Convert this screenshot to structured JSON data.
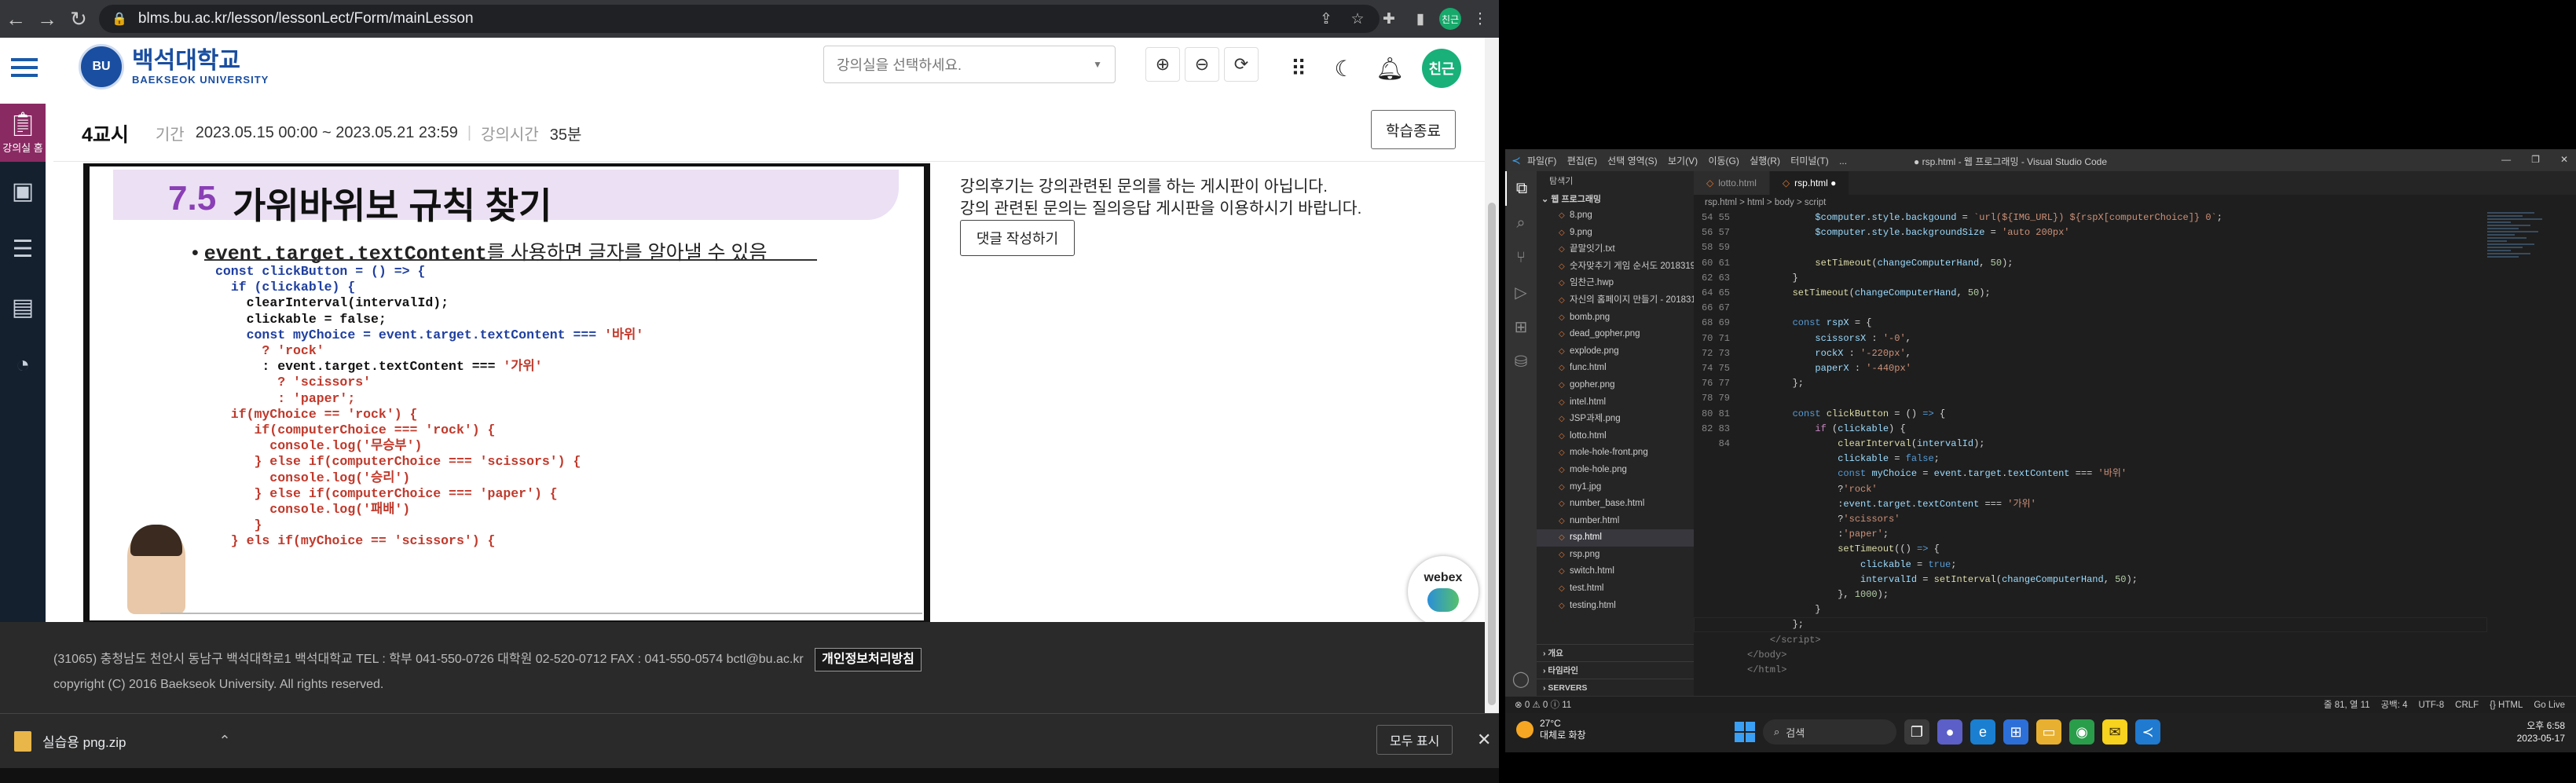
{
  "browser": {
    "url": "blms.bu.ac.kr/lesson/lessonLect/Form/mainLesson",
    "profile": "친근"
  },
  "site": {
    "logo_badge": "BU",
    "name_ko": "백석대학교",
    "name_en": "BAEKSEOK UNIVERSITY",
    "room_placeholder": "강의실을 선택하세요.",
    "user_avatar": "친근",
    "side_label": "강의실 홈"
  },
  "lesson": {
    "name": "4교시",
    "period_label": "기간",
    "period": "2023.05.15 00:00 ~ 2023.05.21 23:59",
    "separator": "|",
    "time_label": "강의시간",
    "time": "35분",
    "end_button": "학습종료"
  },
  "slide": {
    "number": "7.5",
    "title": "가위바위보 규칙 찾기",
    "bullet_code": "event.target.textContent",
    "bullet_rest": "를 사용하면 글자를 알아낼 수 있음"
  },
  "review": {
    "line1": "강의후기는 강의관련된 문의를 하는 게시판이 아닙니다.",
    "line2": "강의 관련된 문의는 질의응답 게시판을 이용하시기 바랍니다.",
    "write_button": "댓글 작성하기"
  },
  "webex": "webex",
  "footer": {
    "address": "(31065) 충청남도 천안시 동남구 백석대학로1 백석대학교 TEL : 학부 041-550-0726 대학원 02-520-0712 FAX : 041-550-0574 bctl@bu.ac.kr",
    "privacy_button": "개인정보처리방침",
    "copyright": "copyright (C) 2016 Baekseok University. All rights reserved."
  },
  "download": {
    "file": "실습용 png.zip",
    "show_all": "모두 표시"
  },
  "vscode": {
    "menus": [
      "파일(F)",
      "편집(E)",
      "선택 영역(S)",
      "보기(V)",
      "이동(G)",
      "실행(R)",
      "터미널(T)",
      "..."
    ],
    "window_title": "● rsp.html - 웹 프로그래밍 - Visual Studio Code",
    "explorer_title": "탐색기",
    "project": "웹 프로그래밍",
    "files": [
      "8.png",
      "9.png",
      "끝말잇기.txt",
      "숫자맞추기 게임 순서도 20183195임찬...",
      "임찬근.hwp",
      "자신의 홈페이지 만들기 - 20183195.zip",
      "bomb.png",
      "dead_gopher.png",
      "explode.png",
      "func.html",
      "gopher.png",
      "intel.html",
      "JSP과제.png",
      "lotto.html",
      "mole-hole-front.png",
      "mole-hole.png",
      "my1.jpg",
      "number_base.html",
      "number.html",
      "rsp.html",
      "rsp.png",
      "switch.html",
      "test.html",
      "testing.html"
    ],
    "selected_file": "rsp.html",
    "sections": [
      "개요",
      "타임라인",
      "SERVERS"
    ],
    "tabs": [
      "lotto.html",
      "rsp.html"
    ],
    "breadcrumb": "rsp.html > html > body > script",
    "status_left": "⊗ 0 ⚠ 0  ⓘ 11",
    "status_right": [
      "줄 81, 열 11",
      "공백: 4",
      "UTF-8",
      "CRLF",
      "{} HTML",
      "Go Live"
    ]
  },
  "taskbar": {
    "temp": "27°C",
    "weather": "대체로 화창",
    "search": "검색",
    "time": "오후 6:58",
    "date": "2023-05-17"
  }
}
